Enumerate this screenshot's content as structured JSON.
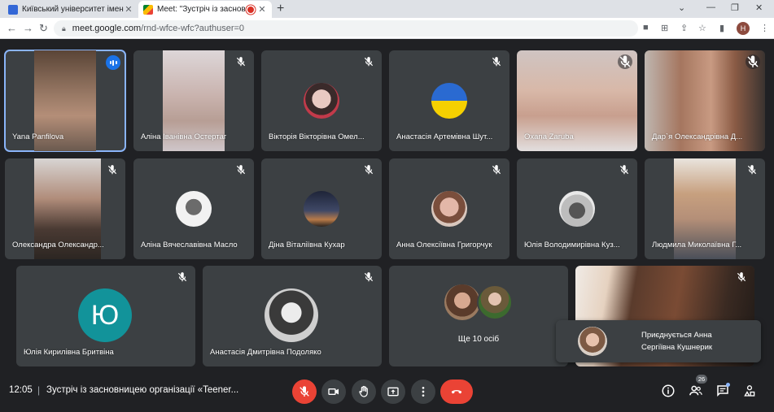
{
  "browser": {
    "tabs": [
      {
        "title": "Київський університет імені Бор",
        "active": false
      },
      {
        "title": "Meet: \"Зустріч із засновниц",
        "active": true
      }
    ],
    "url_host": "meet.google.com",
    "url_path": "/rnd-wfce-wfc?authuser=0",
    "profile_initial": "H"
  },
  "participants_row1": [
    {
      "name": "Yana Panfilova",
      "speaking": true
    },
    {
      "name": "Аліна Іванівна Остертаг"
    },
    {
      "name": "Вікторія Вікторівна Омел..."
    },
    {
      "name": "Анастасія Артемівна Шут..."
    },
    {
      "name": "Oxana Zaruba"
    },
    {
      "name": "Дар`я Олександрівна Д..."
    }
  ],
  "participants_row2": [
    {
      "name": "Олександра Олександр..."
    },
    {
      "name": "Аліна Вячеславівна Масло"
    },
    {
      "name": "Діна Віталіївна Кухар"
    },
    {
      "name": "Анна Олексіївна Григорчук"
    },
    {
      "name": "Юлія Володимирівна Куз..."
    },
    {
      "name": "Людмила Миколаївна Г..."
    }
  ],
  "participants_row3": [
    {
      "name": "Юлія Кирилівна Бритвіна",
      "avatar_letter": "Ю"
    },
    {
      "name": "Анастасія Дмитрівна Подоляко"
    }
  ],
  "more_participants": "Ще 10 осіб",
  "toast": {
    "text": "Приєднується Анна Сергіївна Кушнерик"
  },
  "bottom": {
    "time": "12:05",
    "separator": "|",
    "meeting_title": "Зустріч із засновницею організації «Teener...",
    "people_count": "26"
  },
  "colors": {
    "accent": "#8ab4f8",
    "danger": "#ea4335",
    "tile": "#3c4043",
    "background": "#202124"
  }
}
